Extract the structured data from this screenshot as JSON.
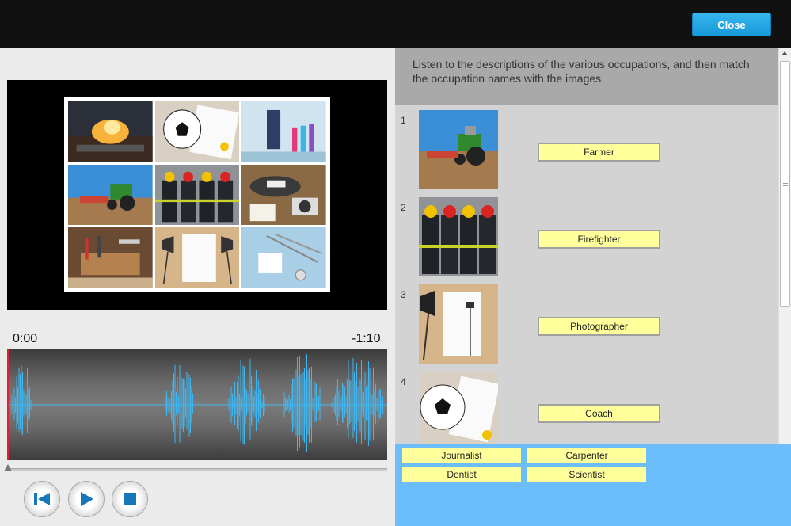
{
  "header": {
    "close_label": "Close"
  },
  "player": {
    "time_elapsed": "0:00",
    "time_remaining": "-1:10",
    "progress": 0,
    "collage_tiles": [
      "cooking-scene",
      "soccer-ball",
      "laboratory",
      "tractor-field",
      "firefighter-gear",
      "journalist-camera",
      "carpenter-tools",
      "photo-studio",
      "dental-tools"
    ],
    "controls": [
      "rewind-icon",
      "play-icon",
      "stop-icon"
    ]
  },
  "exercise": {
    "instructions": "Listen to the descriptions of the various occupations, and then match the occupation names with the images.",
    "rows": [
      {
        "number": "1",
        "image": "tractor-field",
        "answer": "Farmer"
      },
      {
        "number": "2",
        "image": "firefighter-gear",
        "answer": "Firefighter"
      },
      {
        "number": "3",
        "image": "photo-studio",
        "answer": "Photographer"
      },
      {
        "number": "4",
        "image": "soccer-ball",
        "answer": "Coach"
      }
    ]
  },
  "word_bank": [
    "Journalist",
    "Carpenter",
    "Dentist",
    "Scientist"
  ],
  "colors": {
    "accent": "#1ea5e3",
    "answer_bg": "#ffff9c",
    "bank_bg": "#6cbdfb",
    "waveform": "#3fb6f0",
    "playhead": "#dd2233"
  }
}
